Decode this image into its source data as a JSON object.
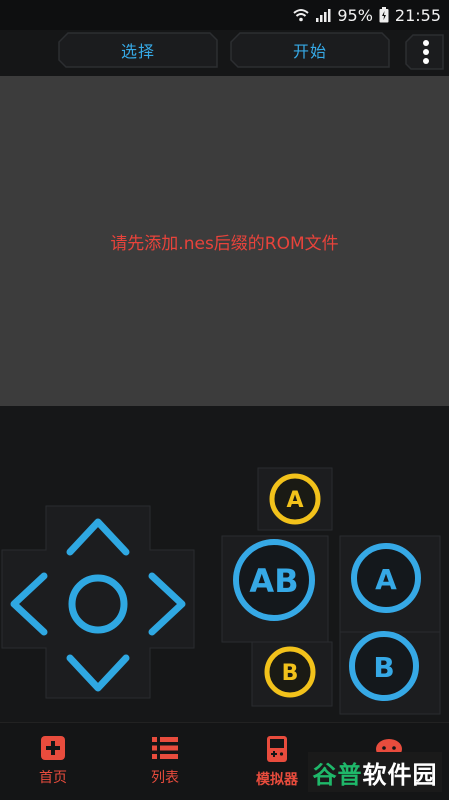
{
  "status_bar": {
    "battery": "95%",
    "time": "21:55"
  },
  "toolbar": {
    "select_label": "选择",
    "start_label": "开始"
  },
  "screen": {
    "message": "请先添加.nes后缀的ROM文件"
  },
  "gamepad": {
    "turbo_a_label": "A",
    "ab_label": "AB",
    "a_label": "A",
    "b_label": "B",
    "turbo_b_label": "B"
  },
  "bottom_nav": {
    "items": [
      {
        "label": "首页",
        "icon": "home-plus-icon"
      },
      {
        "label": "列表",
        "icon": "list-icon"
      },
      {
        "label": "模拟器",
        "icon": "gameboy-icon"
      }
    ]
  },
  "watermark": {
    "part1": "谷普",
    "part2": "软件园"
  },
  "colors": {
    "accent_blue": "#36a9e6",
    "accent_yellow": "#f2c21b",
    "accent_red": "#e8433b"
  }
}
